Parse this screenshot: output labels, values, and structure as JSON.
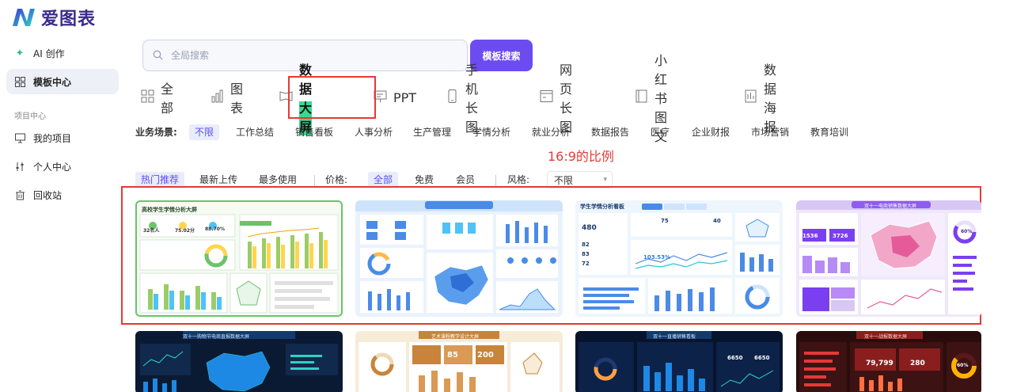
{
  "brand": {
    "name": "爱图表"
  },
  "sidebar": {
    "items": [
      {
        "label": "AI 创作",
        "icon": "sparkle-icon"
      },
      {
        "label": "模板中心",
        "icon": "grid-icon"
      }
    ],
    "section_title": "项目中心",
    "project_items": [
      {
        "label": "我的项目",
        "icon": "monitor-icon"
      },
      {
        "label": "个人中心",
        "icon": "sliders-icon"
      },
      {
        "label": "回收站",
        "icon": "trash-icon"
      }
    ]
  },
  "search": {
    "placeholder": "全局搜索",
    "value": "",
    "button_label": "模板搜索"
  },
  "tabs": [
    {
      "label": "全部",
      "icon": "grid-icon"
    },
    {
      "label": "图表",
      "icon": "bar-chart-icon"
    },
    {
      "label": "数据大屏",
      "icon": "screen-icon",
      "active": true
    },
    {
      "label": "PPT",
      "icon": "presentation-icon"
    },
    {
      "label": "手机长图",
      "icon": "phone-icon"
    },
    {
      "label": "网页长图",
      "icon": "browser-icon"
    },
    {
      "label": "小红书图文",
      "icon": "book-icon"
    },
    {
      "label": "数据海报",
      "icon": "document-icon"
    }
  ],
  "scenes": {
    "label": "业务场景:",
    "items": [
      "不限",
      "工作总结",
      "销售看板",
      "人事分析",
      "生产管理",
      "学情分析",
      "就业分析",
      "数据报告",
      "医疗",
      "企业财报",
      "市场营销",
      "教育培训"
    ],
    "selected": "不限"
  },
  "annotation": {
    "text": "16:9的比例"
  },
  "sort": {
    "items": [
      "热门推荐",
      "最新上传",
      "最多使用"
    ],
    "selected": "热门推荐"
  },
  "price": {
    "label": "价格:",
    "items": [
      "全部",
      "免费",
      "会员"
    ],
    "selected": "全部"
  },
  "style": {
    "label": "风格:",
    "value": "不限"
  },
  "templates": [
    {
      "title": "高校学生学情分析大屏",
      "theme": "light-green",
      "stats": [
        "32名人",
        "75.02分",
        "88.70%"
      ]
    },
    {
      "title": "",
      "theme": "light-blue"
    },
    {
      "title": "学生学情分析看板",
      "theme": "light-sky",
      "stats": [
        "480",
        "82",
        "83",
        "72",
        "75",
        "40",
        "103.53%"
      ]
    },
    {
      "title": "双十一电商销售数据大屏",
      "theme": "light-purple",
      "stats": [
        "1536",
        "3726",
        "60%"
      ]
    },
    {
      "title": "双十一购物节电商直报数据大屏",
      "theme": "dark-navy"
    },
    {
      "title": "艺术课程教学设计大屏",
      "theme": "cream",
      "stats": [
        "85",
        "200"
      ]
    },
    {
      "title": "双十一直播销售看板",
      "theme": "dark-blue",
      "stats": [
        "6650",
        "6650"
      ]
    },
    {
      "title": "双十一战报数据大屏",
      "theme": "dark-red",
      "stats": [
        "79,799",
        "280",
        "60%"
      ]
    }
  ],
  "colors": {
    "accent": "#6c4cf1",
    "annotation": "#e53935",
    "highlight": "#3bd88f"
  }
}
